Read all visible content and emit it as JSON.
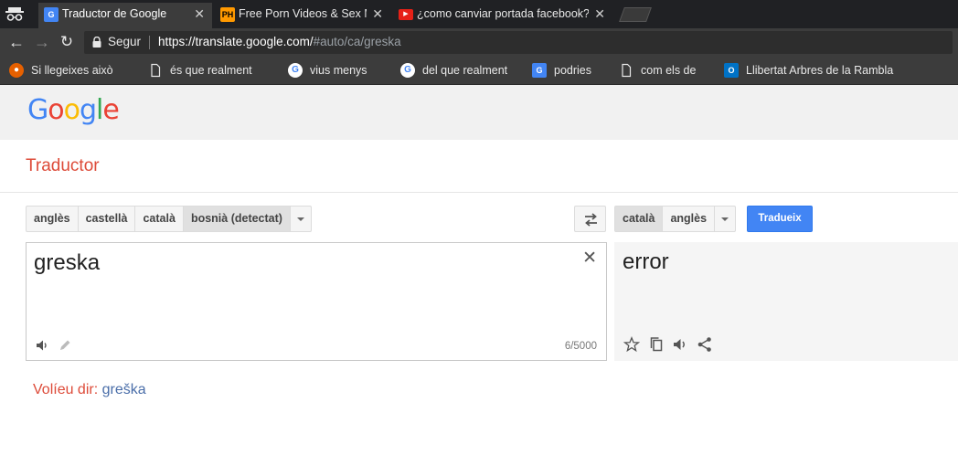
{
  "browser": {
    "tabs": [
      {
        "title": "Traductor de Google",
        "favicon": "google-translate-icon",
        "active": true
      },
      {
        "title": "Free Porn Videos & Sex M",
        "favicon_text": "PH",
        "active": false
      },
      {
        "title": "¿como canviar portada facebook? -",
        "favicon": "youtube-icon",
        "active": false
      }
    ],
    "tab_close_glyph": "✕",
    "secure_label": "Segur",
    "url_host": "https://translate.google.com/",
    "url_path": "#auto/ca/greska",
    "bookmarks": [
      {
        "label": "Si llegeixes això",
        "icon": "firefox-icon"
      },
      {
        "label": "és que realment",
        "icon": "page-icon"
      },
      {
        "label": "vius menys",
        "icon": "google-icon"
      },
      {
        "label": "del que realment",
        "icon": "google-icon"
      },
      {
        "label": "podries",
        "icon": "google-translate-icon"
      },
      {
        "label": "com els de",
        "icon": "page-icon"
      },
      {
        "label": "Llibertat Arbres de la Rambla",
        "icon": "outlook-icon"
      }
    ]
  },
  "header": {
    "logo": [
      "G",
      "o",
      "o",
      "g",
      "l",
      "e"
    ],
    "app_title": "Traductor"
  },
  "source_langs": [
    {
      "label": "anglès",
      "selected": false
    },
    {
      "label": "castellà",
      "selected": false
    },
    {
      "label": "català",
      "selected": false
    },
    {
      "label": "bosnià (detectat)",
      "selected": true
    }
  ],
  "target_langs": [
    {
      "label": "català",
      "selected": true
    },
    {
      "label": "anglès",
      "selected": false
    }
  ],
  "translate_button": "Tradueix",
  "source": {
    "text": "greska",
    "clear_glyph": "✕",
    "char_count": "6/5000"
  },
  "result": {
    "text": "error"
  },
  "suggestion": {
    "label": "Volíeu dir:",
    "link": "greška"
  },
  "colors": {
    "accent_red": "#dd4b39",
    "button_blue": "#4285f4"
  }
}
